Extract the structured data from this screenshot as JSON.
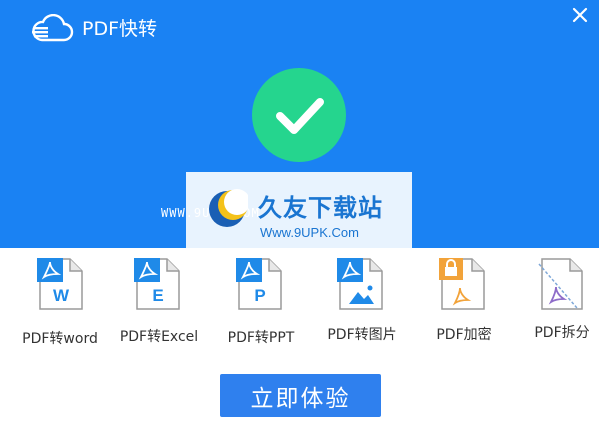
{
  "app": {
    "title": "PDF快转"
  },
  "watermark": {
    "small": "WWW.9UPK.COM",
    "title": "久友下载站",
    "url": "Www.9UPK.Com"
  },
  "tools": [
    {
      "label": "PDF转word",
      "letter": "W",
      "icon": "pdf-to-word-icon"
    },
    {
      "label": "PDF转Excel",
      "letter": "E",
      "icon": "pdf-to-excel-icon"
    },
    {
      "label": "PDF转PPT",
      "letter": "P",
      "icon": "pdf-to-ppt-icon"
    },
    {
      "label": "PDF转图片",
      "letter": "",
      "icon": "pdf-to-image-icon"
    },
    {
      "label": "PDF加密",
      "letter": "",
      "icon": "pdf-encrypt-icon"
    },
    {
      "label": "PDF拆分",
      "letter": "",
      "icon": "pdf-split-icon"
    }
  ],
  "cta": {
    "label": "立即体验"
  },
  "colors": {
    "header": "#1a82f3",
    "success": "#25d58e",
    "button": "#2f80ee",
    "pdf_blue": "#1f8ae8",
    "pdf_orange": "#f2a33a",
    "pdf_purple": "#8e6cc9"
  }
}
